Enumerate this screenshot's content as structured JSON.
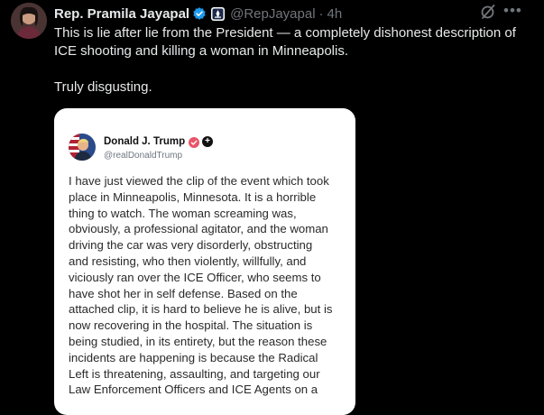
{
  "tweet": {
    "author_name": "Rep. Pramila Jayapal",
    "author_handle": "@RepJayapal",
    "separator": "·",
    "time": "4h",
    "paragraphs": [
      "This is lie after lie from the President — a completely dishonest description of ICE shooting and killing a woman in Minneapolis.",
      "Truly disgusting."
    ]
  },
  "icons": {
    "verified": "verified-badge-icon",
    "affiliation": "government-affiliation-icon",
    "grok": "grok-icon",
    "more": "more-icon"
  },
  "embedded_post": {
    "author_name": "Donald J. Trump",
    "author_handle": "@realDonaldTrump",
    "body_lines": [
      "I have just viewed the clip of the event which took",
      "place in Minneapolis, Minnesota. It is a horrible",
      "thing to watch. The woman screaming was,",
      "obviously, a professional agitator, and the woman",
      "driving the car was very disorderly, obstructing",
      "and resisting, who then violently, willfully, and",
      "viciously ran over the ICE Officer, who seems to",
      "have shot her in self defense. Based on the",
      "attached clip, it is hard to believe he is alive, but is",
      "now recovering in the hospital. The situation is",
      "being studied, in its entirety, but the reason these",
      "incidents are happening is because the Radical",
      "Left is threatening, assaulting, and targeting our",
      "Law Enforcement Officers and ICE Agents on a"
    ]
  },
  "colors": {
    "background": "#000000",
    "text_primary": "#e7e9ea",
    "text_secondary": "#71767b",
    "verified_blue": "#1d9bf0",
    "card_background": "#ffffff"
  }
}
